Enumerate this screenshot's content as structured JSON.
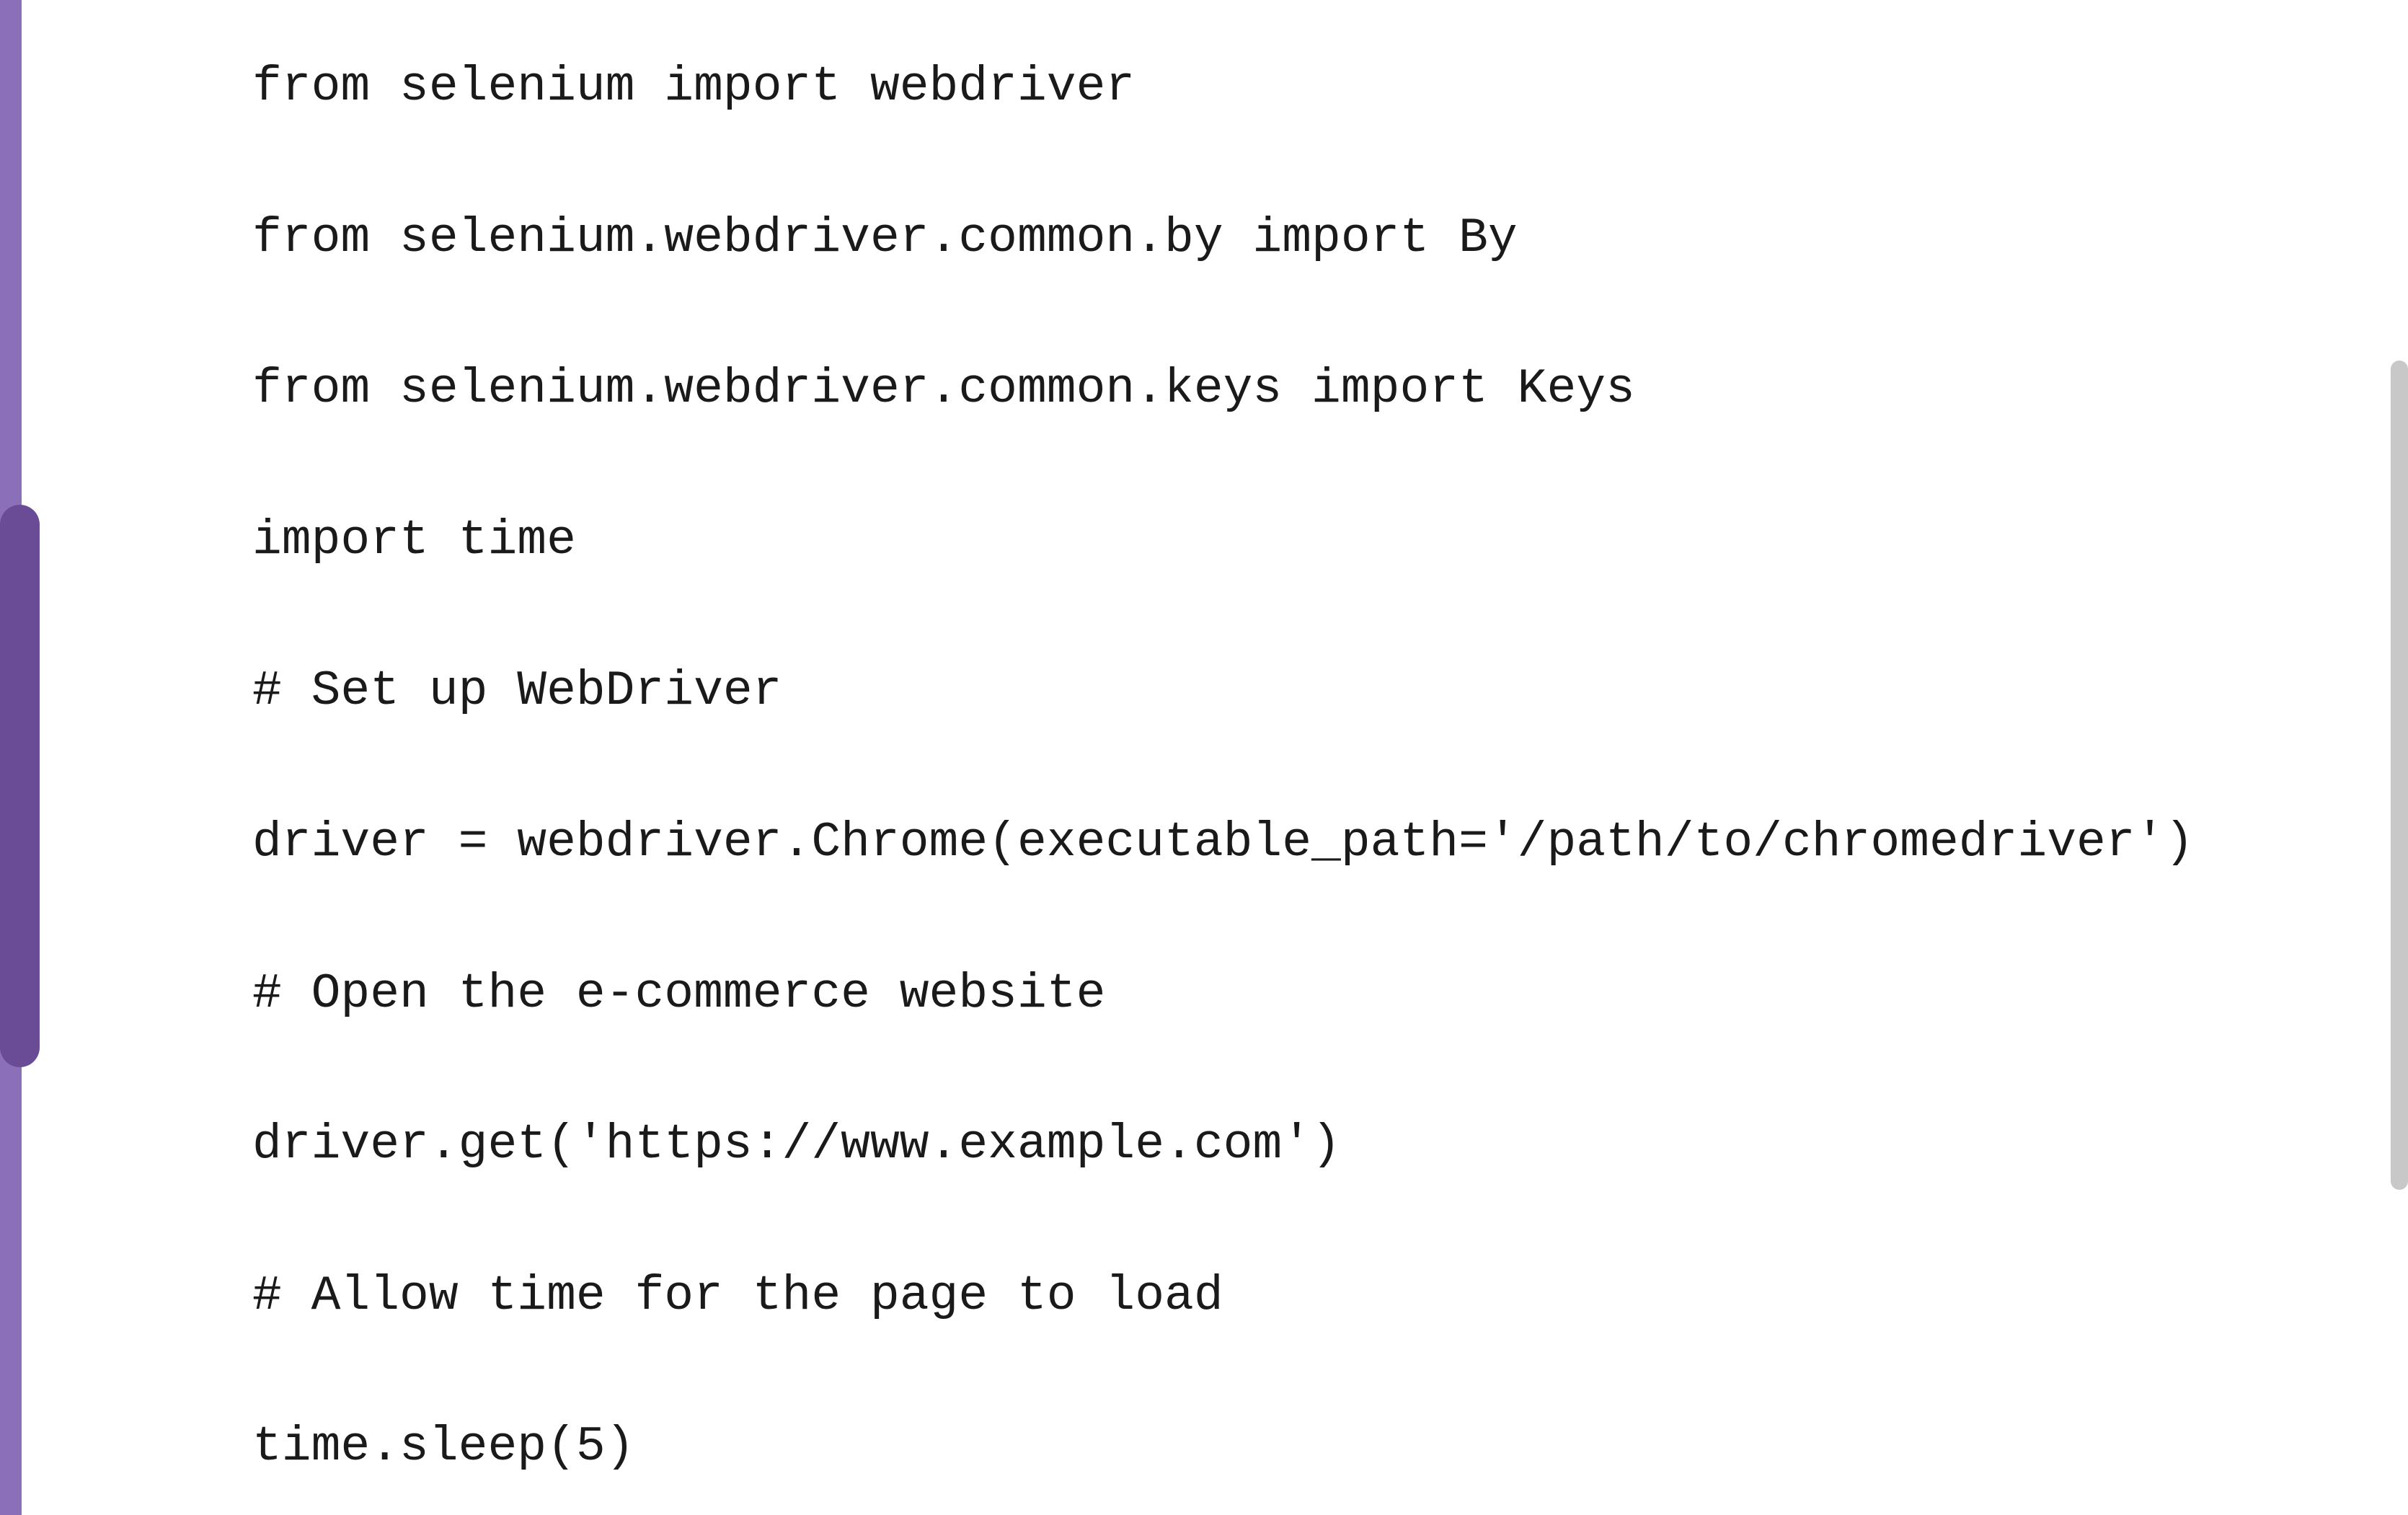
{
  "code": {
    "lines": [
      "from selenium import webdriver",
      "from selenium.webdriver.common.by import By",
      "from selenium.webdriver.common.keys import Keys",
      "import time",
      "# Set up WebDriver",
      "driver = webdriver.Chrome(executable_path='/path/to/chromedriver')",
      "# Open the e-commerce website",
      "driver.get('https://www.example.com')",
      "# Allow time for the page to load",
      "time.sleep(5)"
    ]
  },
  "colors": {
    "leftBorder": "#8b6fb8",
    "leftThumb": "#6a4c96",
    "rightThumb": "#c8c8c8",
    "text": "#1a1a1a",
    "background": "#ffffff"
  }
}
